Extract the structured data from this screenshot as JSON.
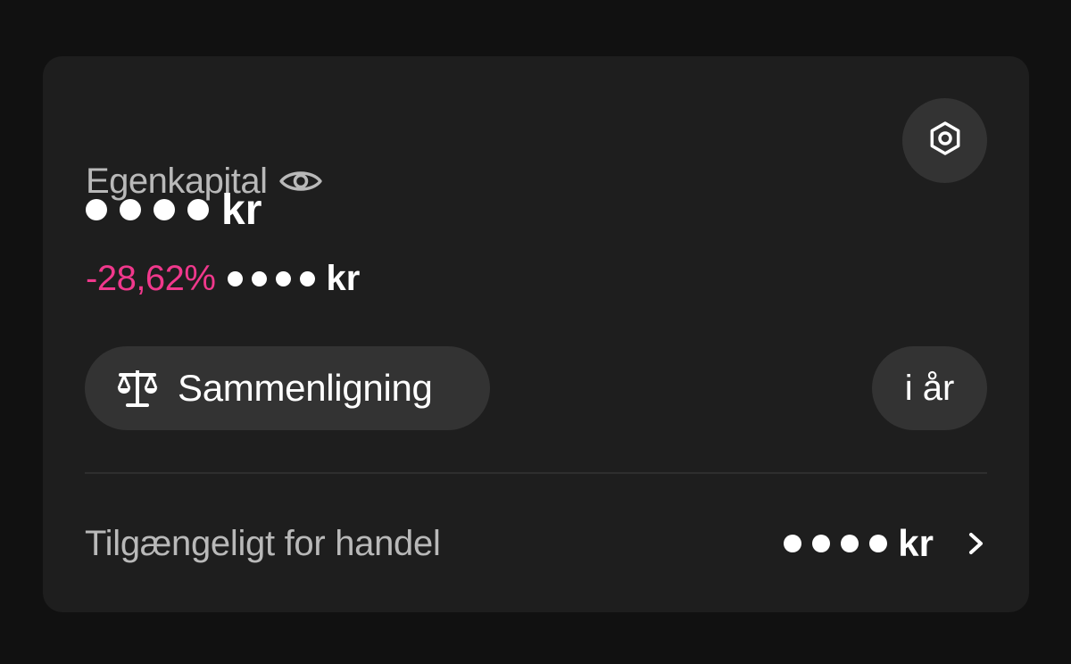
{
  "card": {
    "title": "Egenkapital",
    "equity_currency": "kr",
    "change_percent": "-28,62%",
    "change_currency": "kr",
    "compare_label": "Sammenligning",
    "period_label": "i år",
    "available_label": "Tilgængeligt for handel",
    "available_currency": "kr"
  },
  "icons": {
    "visibility": "eye-icon",
    "settings": "gear-icon",
    "compare": "scale-icon",
    "open_available": "chevron-right-icon"
  },
  "colors": {
    "negative": "#f0388c",
    "button_bg": "#333333",
    "card_bg": "#1e1e1e"
  }
}
